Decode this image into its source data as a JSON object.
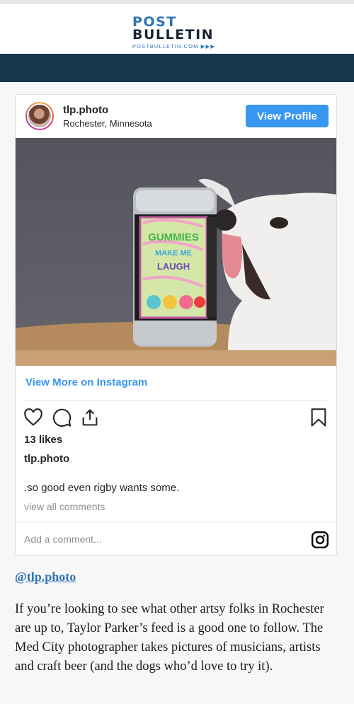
{
  "header": {
    "logo_line1": "POST",
    "logo_line2": "BULLETIN",
    "logo_url": "POSTBULLETIN.COM ▶▶▶"
  },
  "embed": {
    "username": "tlp.photo",
    "location": "Rochester, Minnesota",
    "view_profile_label": "View Profile",
    "can_text_1": "GUMMIES",
    "can_text_2": "MAKE ME",
    "can_text_3": "LAUGH",
    "view_more_label": "View More on Instagram",
    "likes": "13 likes",
    "caption_user": "tlp.photo",
    "caption": ".so good even rigby wants some.",
    "view_comments": "view all comments",
    "comment_placeholder": "Add a comment..."
  },
  "icons": {
    "like": "heart-icon",
    "comment": "comment-icon",
    "share": "share-icon",
    "save": "bookmark-icon",
    "instagram": "instagram-icon"
  },
  "colors": {
    "accent": "#3897f0",
    "nav": "#17384f",
    "brand": "#2f74b6"
  },
  "article": {
    "handle": "@tlp.photo",
    "body": "If you’re looking to see what other artsy folks in Rochester are up to, Taylor Parker’s feed is a good one to follow. The Med City photographer takes pictures of musicians, artists and craft beer (and the dogs who’d love to try it)."
  }
}
